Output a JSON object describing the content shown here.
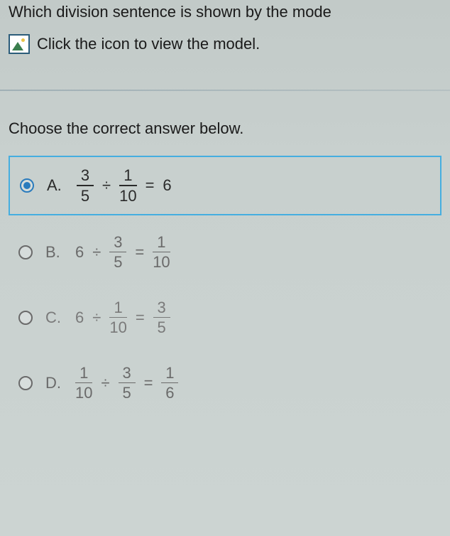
{
  "question": "Which division sentence is shown by the mode",
  "icon_instruction": "Click the icon to view the model.",
  "instruction": "Choose the correct answer below.",
  "choices": {
    "a": {
      "letter": "A.",
      "frac1_num": "3",
      "frac1_den": "5",
      "op": "÷",
      "frac2_num": "1",
      "frac2_den": "10",
      "eq": "=",
      "result": "6",
      "selected": true
    },
    "b": {
      "letter": "B.",
      "lhs": "6",
      "op": "÷",
      "frac1_num": "3",
      "frac1_den": "5",
      "eq": "=",
      "frac2_num": "1",
      "frac2_den": "10",
      "selected": false
    },
    "c": {
      "letter": "C.",
      "lhs": "6",
      "op": "÷",
      "frac1_num": "1",
      "frac1_den": "10",
      "eq": "=",
      "frac2_num": "3",
      "frac2_den": "5",
      "selected": false
    },
    "d": {
      "letter": "D.",
      "frac1_num": "1",
      "frac1_den": "10",
      "op": "÷",
      "frac2_num": "3",
      "frac2_den": "5",
      "eq": "=",
      "frac3_num": "1",
      "frac3_den": "6",
      "selected": false
    }
  }
}
